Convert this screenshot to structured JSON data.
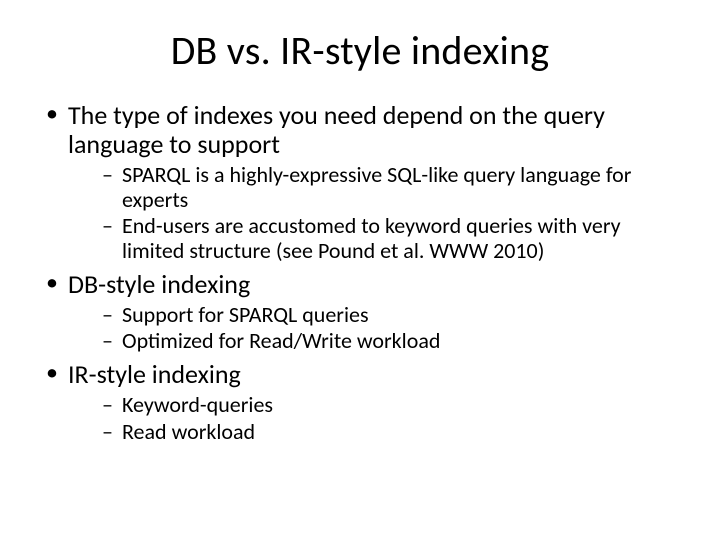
{
  "title": "DB vs. IR-style indexing",
  "bullets": [
    {
      "text": "The type of indexes you need depend on the query language to support",
      "sub": [
        "SPARQL is a highly-expressive SQL-like query language for experts",
        "End-users are accustomed to keyword queries with very limited structure (see Pound et al. WWW 2010)"
      ]
    },
    {
      "text": "DB-style indexing",
      "sub": [
        "Support for SPARQL queries",
        "Optimized for Read/Write workload"
      ]
    },
    {
      "text": "IR-style indexing",
      "sub": [
        "Keyword-queries",
        "Read workload"
      ]
    }
  ]
}
